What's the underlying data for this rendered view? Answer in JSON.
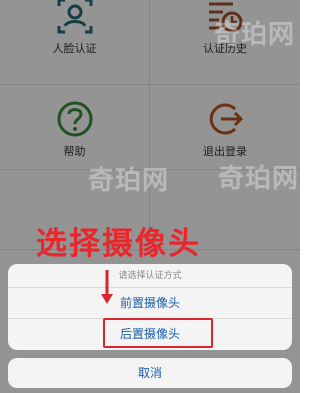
{
  "menu": {
    "items": [
      {
        "label": "人脸认证",
        "icon": "face-scan-icon"
      },
      {
        "label": "认证历史",
        "icon": "history-list-icon"
      },
      {
        "label": "帮助",
        "icon": "help-icon"
      },
      {
        "label": "退出登录",
        "icon": "logout-icon"
      }
    ]
  },
  "annotation": {
    "title": "选择摄像头"
  },
  "watermarks": [
    "奇珀网",
    "奇珀网",
    "奇珀网"
  ],
  "action_sheet": {
    "header": "请选择认证方式",
    "front_camera": "前置摄像头",
    "rear_camera": "后置摄像头",
    "cancel": "取消"
  },
  "colors": {
    "teal": "#1f6f78",
    "brown": "#a0522d",
    "green": "#3c8c3c",
    "dark_orange": "#b8561f",
    "link_blue": "#1a5ea8",
    "annotation_red": "#e8262c"
  }
}
